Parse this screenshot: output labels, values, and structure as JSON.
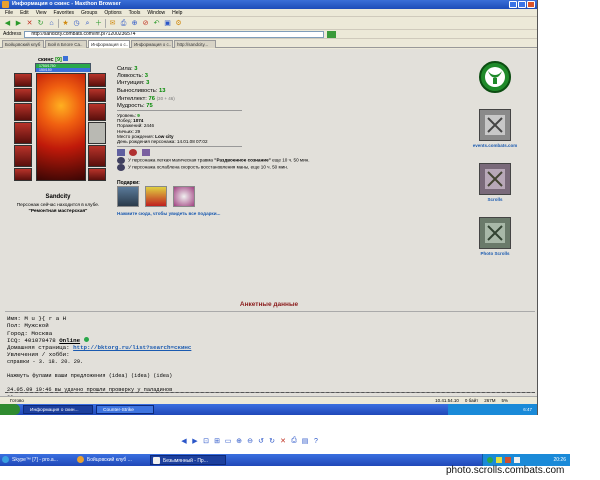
{
  "browser": {
    "title": "Информация о скинс - Maxthon Browser",
    "menu": [
      "File",
      "Edit",
      "View",
      "Favorites",
      "Groups",
      "Options",
      "Tools",
      "Window",
      "Help"
    ],
    "address_label": "Address",
    "url": "http://sandcity.combats.com/inf.pl?1200236574",
    "tabs": [
      "Бойцовский клуб",
      "Бой в Блоге Ca..",
      "Информация о с..",
      "Информация о с..",
      "http://sandcity..."
    ],
    "active_tab": 2
  },
  "character": {
    "nick": "скинс",
    "level": "[9]",
    "hp": "1750/1750",
    "mp": "150/150",
    "city_name": "Sandcity",
    "location_line1": "Персонаж сейчас находится в клубе.",
    "location_line2": "\"Ремонтная мастерская\""
  },
  "stats": [
    {
      "label": "Сила:",
      "value": "3"
    },
    {
      "label": "Ловкость:",
      "value": "3"
    },
    {
      "label": "Интуиция:",
      "value": "3"
    },
    {
      "label": "Выносливость:",
      "value": "13"
    },
    {
      "label": "Интеллект:",
      "value": "76",
      "extra": "(30 + 46)"
    },
    {
      "label": "Мудрость:",
      "value": "75"
    }
  ],
  "info": [
    {
      "label": "Уровень:",
      "value": "9"
    },
    {
      "label": "Побед:",
      "value": "1074"
    },
    {
      "label": "Поражений:",
      "value": "2446"
    },
    {
      "label": "Ничьих:",
      "value": "29"
    },
    {
      "label": "Место рождения:",
      "value": "Low city"
    },
    {
      "label": "День рождения персонажа:",
      "value": "14.01.08 07:02"
    }
  ],
  "effects": [
    {
      "prefix": "У персонажа легкая магическая травма ",
      "name": "\"Раздвоенное сознание\"",
      "suffix": " еще 10 ч. 50 мин."
    },
    {
      "prefix": "У персонажа ослаблена скорость восстановления маны, еще 10 ч. 50 мин.",
      "name": "",
      "suffix": ""
    }
  ],
  "gifts": {
    "title": "Подарки:",
    "link": "Нажмите сюда, чтобы увидеть все подарки..."
  },
  "right_links": [
    {
      "label": ""
    },
    {
      "label": "events.combats.com"
    },
    {
      "label": "Scrolls"
    },
    {
      "label": "Photo Scrolls"
    }
  ],
  "anketa": {
    "title": "Анкетные данные",
    "name_label": "Имя:",
    "name_value": "M u }{ r a H",
    "gender_label": "Пол:",
    "gender_value": "Мужской",
    "city_label": "Город:",
    "city_value": "Москва",
    "icq_label": "ICQ:",
    "icq_value": "401070478",
    "icq_status": "Online",
    "homepage_label": "Домашняя страница:",
    "homepage_value": "http://bktorg.ru/list?search=скинс",
    "hobby_label": "Увлечения / хобби:",
    "hobby_value": "справки - 3. 18. 20. 29.",
    "note1": "Нажмуть фулами ваши предложения  (idea)  (idea)  (idea)",
    "note2": "24.05.09 19:46 вы удачно прошли проверку у паладинов",
    "note3": "29"
  },
  "statusbar": {
    "left": "Готово",
    "right": [
      "10.41.54.10",
      "0 байт",
      "267M",
      "5%"
    ]
  },
  "inner_taskbar": {
    "tasks": [
      "Информация о скин...",
      "Counter-Strike"
    ],
    "tray_time": "6:47"
  },
  "taskbar": {
    "tasks": [
      "Skype™ [7] - pro.a...",
      "Бойцовский клуб ...",
      "Безымянный - Пр..."
    ],
    "clock": "20:26"
  },
  "watermark": "photo.scrolls.combats.com"
}
